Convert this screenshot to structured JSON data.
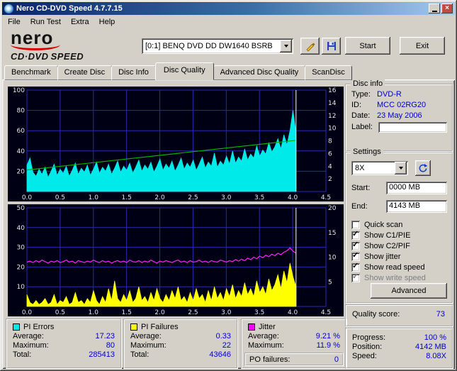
{
  "window": {
    "title": "Nero CD-DVD Speed 4.7.7.15",
    "controls": [
      "minimize-icon",
      "close-icon"
    ]
  },
  "menubar": {
    "items": [
      "File",
      "Run Test",
      "Extra",
      "Help"
    ]
  },
  "logo": {
    "brand": "nero",
    "cd_dvd": "CD·DVD",
    "speed": "SPEED"
  },
  "toolbar": {
    "drive_selector": "[0:1]   BENQ DVD DD DW1640 BSRB",
    "start_button": "Start",
    "exit_button": "Exit",
    "icons": [
      "chevron-down-icon",
      "write-icon",
      "save-icon"
    ]
  },
  "tabs": {
    "items": [
      "Benchmark",
      "Create Disc",
      "Disc Info",
      "Disc Quality",
      "Advanced Disc Quality",
      "ScanDisc"
    ],
    "active_index": 3
  },
  "disc_info": {
    "title": "Disc info",
    "rows": [
      {
        "label": "Type:",
        "value": "DVD-R"
      },
      {
        "label": "ID:",
        "value": "MCC 02RG20"
      },
      {
        "label": "Date:",
        "value": "23 May 2006"
      },
      {
        "label": "Label:",
        "value": "",
        "field": true
      }
    ]
  },
  "settings": {
    "title": "Settings",
    "speed_value": "8X",
    "refresh_icon": "refresh-icon",
    "start_label": "Start:",
    "start_value": "0000 MB",
    "end_label": "End:",
    "end_value": "4143 MB",
    "checkboxes": [
      {
        "label": "Quick scan",
        "checked": false,
        "enabled": true
      },
      {
        "label": "Show C1/PIE",
        "checked": true,
        "enabled": true
      },
      {
        "label": "Show C2/PIF",
        "checked": true,
        "enabled": true
      },
      {
        "label": "Show jitter",
        "checked": true,
        "enabled": true
      },
      {
        "label": "Show read speed",
        "checked": true,
        "enabled": true
      },
      {
        "label": "Show write speed",
        "checked": true,
        "enabled": false
      }
    ],
    "advanced_button": "Advanced"
  },
  "quality": {
    "label": "Quality score:",
    "value": "73"
  },
  "stats": {
    "value_color": "#0000cc",
    "pi_errors": {
      "title": "PI Errors",
      "swatch": "#00eaea",
      "rows": [
        [
          "Average:",
          "17.23"
        ],
        [
          "Maximum:",
          "80"
        ],
        [
          "Total:",
          "285413"
        ]
      ]
    },
    "pi_failures": {
      "title": "PI Failures",
      "swatch": "#ffff00",
      "rows": [
        [
          "Average:",
          "0.33"
        ],
        [
          "Maximum:",
          "22"
        ],
        [
          "Total:",
          "43646"
        ]
      ]
    },
    "jitter": {
      "title": "Jitter",
      "swatch": "#ff00ff",
      "rows": [
        [
          "Average:",
          "9.21 %"
        ],
        [
          "Maximum:",
          "11.9 %"
        ]
      ],
      "po_label": "PO failures:",
      "po_value": "0"
    },
    "progress": {
      "rows": [
        [
          "Progress:",
          "100 %"
        ],
        [
          "Position:",
          "4142 MB"
        ],
        [
          "Speed:",
          "8.08X"
        ]
      ]
    }
  },
  "chart_data": [
    {
      "type": "area",
      "name": "pi-errors-read-speed-chart",
      "bg": "#000014",
      "grid": "#2a2ab0",
      "label_color": "#e8e8e8",
      "x_range": [
        0,
        4.5
      ],
      "x_ticks": [
        0,
        0.5,
        1,
        1.5,
        2,
        2.5,
        3,
        3.5,
        4,
        4.5
      ],
      "left_axis": {
        "max": 100,
        "ticks": [
          20,
          40,
          60,
          80,
          100
        ]
      },
      "right_axis": {
        "max": 16,
        "ticks": [
          2,
          4,
          6,
          8,
          10,
          12,
          14,
          16
        ]
      },
      "end_marker_x": 4.05,
      "series": [
        {
          "name": "PI Errors",
          "kind": "area",
          "color": "#00eaea",
          "axis": "left",
          "x_start": 0,
          "x_end": 4.05,
          "values": [
            26,
            33,
            19,
            15,
            22,
            17,
            24,
            14,
            20,
            27,
            16,
            22,
            18,
            25,
            15,
            21,
            28,
            17,
            23,
            19,
            26,
            16,
            22,
            29,
            18,
            24,
            20,
            27,
            17,
            23,
            30,
            19,
            25,
            21,
            28,
            18,
            24,
            31,
            20,
            26,
            22,
            29,
            19,
            25,
            32,
            21,
            27,
            23,
            30,
            20,
            26,
            33,
            22,
            28,
            24,
            31,
            21,
            27,
            34,
            23,
            29,
            25,
            38,
            24,
            30,
            26,
            35,
            27,
            40,
            28,
            34,
            30,
            42,
            31,
            37,
            33,
            45,
            35,
            41,
            37,
            48,
            39,
            44,
            52,
            42,
            56,
            46,
            60,
            80,
            58
          ]
        },
        {
          "name": "Read speed",
          "kind": "line",
          "color": "#00b400",
          "axis": "right",
          "points": [
            [
              0,
              3.4
            ],
            [
              4.05,
              8.08
            ]
          ]
        }
      ]
    },
    {
      "type": "area",
      "name": "pi-failures-jitter-chart",
      "bg": "#000014",
      "grid": "#2a2ab0",
      "label_color": "#e8e8e8",
      "x_range": [
        0,
        4.5
      ],
      "x_ticks": [
        0,
        0.5,
        1,
        1.5,
        2,
        2.5,
        3,
        3.5,
        4,
        4.5
      ],
      "left_axis": {
        "max": 50,
        "ticks": [
          10,
          20,
          30,
          40,
          50
        ]
      },
      "right_axis": {
        "max": 20,
        "ticks": [
          5,
          10,
          15,
          20
        ]
      },
      "end_marker_x": 4.05,
      "series": [
        {
          "name": "PI Failures",
          "kind": "area",
          "color": "#ffff00",
          "axis": "left",
          "x_start": 0,
          "x_end": 4.05,
          "values": [
            6,
            2,
            1,
            3,
            1,
            2,
            4,
            1,
            2,
            6,
            1,
            3,
            2,
            5,
            1,
            2,
            7,
            2,
            3,
            1,
            4,
            2,
            8,
            3,
            1,
            5,
            2,
            9,
            3,
            13,
            4,
            2,
            6,
            3,
            8,
            2,
            4,
            10,
            3,
            5,
            2,
            7,
            3,
            9,
            4,
            2,
            6,
            3,
            8,
            4,
            10,
            3,
            5,
            2,
            7,
            3,
            9,
            4,
            6,
            2,
            8,
            3,
            10,
            4,
            7,
            3,
            9,
            5,
            11,
            4,
            8,
            5,
            12,
            6,
            9,
            5,
            13,
            7,
            10,
            6,
            14,
            8,
            11,
            16,
            9,
            18,
            12,
            22,
            15,
            10
          ]
        },
        {
          "name": "Jitter",
          "kind": "line",
          "color": "#ff20ff",
          "axis": "right",
          "x_start": 0,
          "x_end": 4.05,
          "values": [
            9.0,
            9.2,
            8.9,
            9.3,
            9.0,
            9.4,
            9.1,
            8.8,
            9.2,
            9.0,
            9.3,
            8.9,
            9.1,
            9.4,
            9.0,
            9.2,
            8.8,
            9.3,
            9.1,
            8.9,
            9.2,
            9.0,
            9.4,
            9.1,
            8.9,
            9.3,
            9.0,
            9.2,
            8.8,
            9.1,
            9.3,
            9.0,
            9.2,
            8.9,
            9.4,
            9.1,
            9.0,
            9.3,
            8.9,
            9.2,
            9.0,
            9.4,
            9.1,
            8.8,
            9.2,
            9.0,
            9.3,
            9.1,
            8.9,
            9.2,
            9.4,
            9.0,
            9.2,
            8.9,
            9.3,
            9.0,
            9.1,
            9.4,
            9.0,
            9.2,
            8.9,
            9.3,
            9.1,
            9.0,
            9.4,
            9.2,
            9.0,
            9.3,
            9.1,
            9.5,
            9.2,
            9.6,
            9.3,
            9.8,
            9.5,
            10.0,
            9.7,
            10.2,
            9.9,
            10.4,
            10.1,
            10.6,
            10.3,
            10.8,
            10.5,
            11.0,
            11.3,
            11.9,
            11.2,
            10.8
          ]
        }
      ]
    }
  ]
}
